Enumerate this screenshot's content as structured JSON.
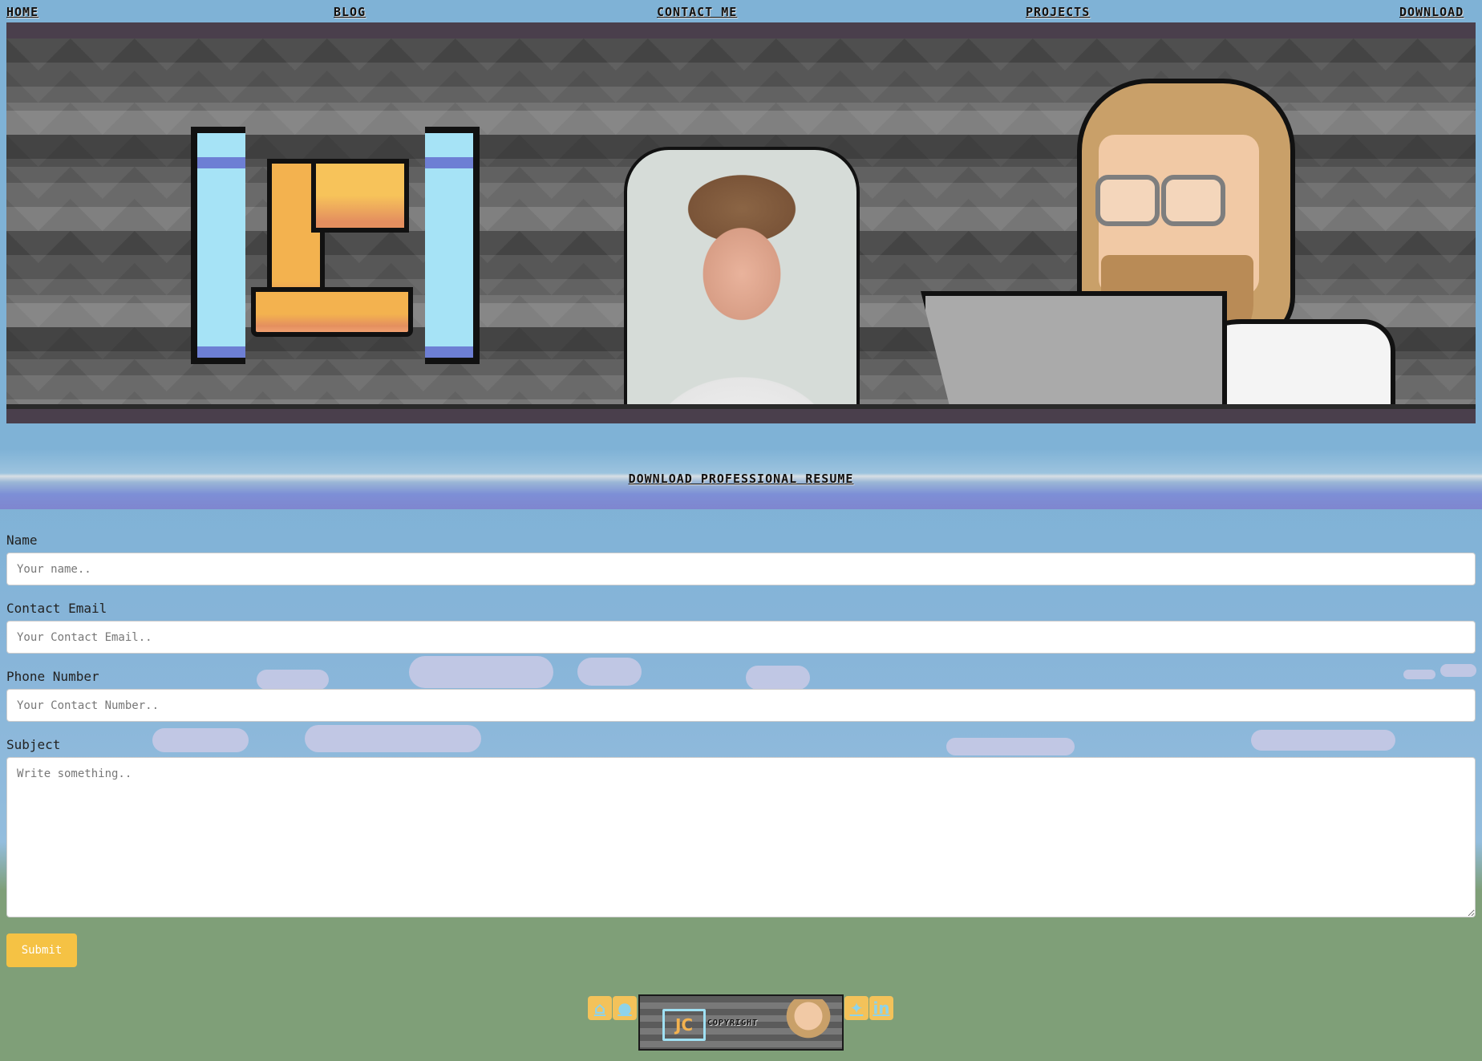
{
  "nav": {
    "items": [
      {
        "label": "HOME"
      },
      {
        "label": "BLOG"
      },
      {
        "label": "CONTACT ME"
      },
      {
        "label": "PROJECTS"
      },
      {
        "label": "DOWNLOAD"
      }
    ]
  },
  "download": {
    "label": "DOWNLOAD PROFESSIONAL RESUME"
  },
  "form": {
    "name": {
      "label": "Name",
      "placeholder": "Your name.."
    },
    "email": {
      "label": "Contact Email",
      "placeholder": "Your Contact Email.."
    },
    "phone": {
      "label": "Phone Number",
      "placeholder": "Your Contact Number.."
    },
    "subject": {
      "label": "Subject",
      "placeholder": "Write something.."
    },
    "submit_label": "Submit"
  },
  "footer": {
    "icons": [
      "home-icon",
      "github-icon",
      "twitter-icon",
      "linkedin-icon"
    ],
    "copyright": "COPYRIGHT"
  },
  "colors": {
    "sky": "#7fb2d6",
    "grass": "#7f9f78",
    "accent": "#f5c244"
  }
}
